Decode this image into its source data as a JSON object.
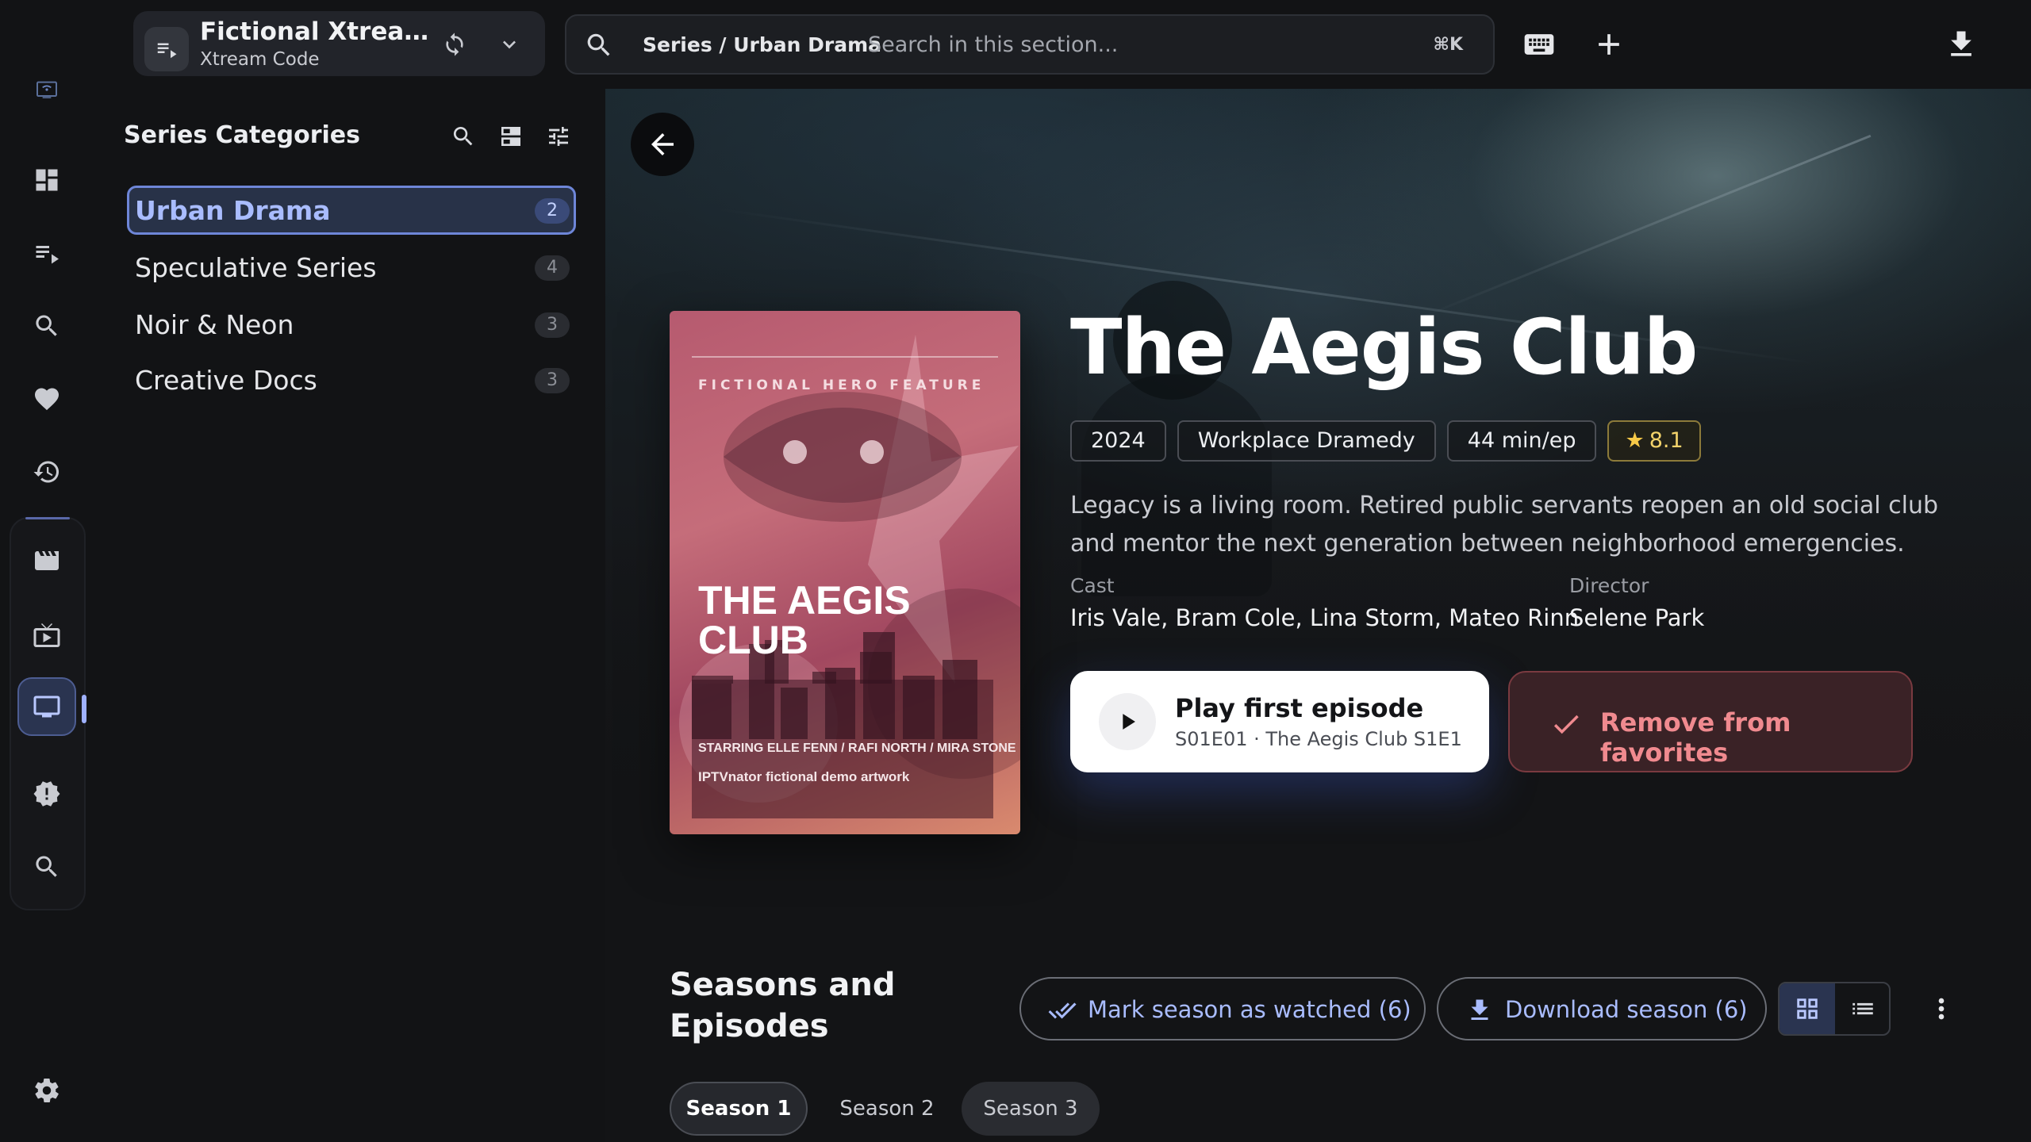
{
  "source": {
    "title": "Fictional Xtream ...",
    "subtitle": "Xtream Code"
  },
  "search": {
    "breadcrumb": "Series / Urban Drama",
    "placeholder": "Search in this section...",
    "shortcut": "⌘K"
  },
  "sidebar": {
    "title": "Series Categories",
    "categories": [
      {
        "label": "Urban Drama",
        "count": "2",
        "active": true
      },
      {
        "label": "Speculative Series",
        "count": "4",
        "active": false
      },
      {
        "label": "Noir & Neon",
        "count": "3",
        "active": false
      },
      {
        "label": "Creative Docs",
        "count": "3",
        "active": false
      }
    ]
  },
  "poster": {
    "kicker": "FICTIONAL HERO FEATURE",
    "title_line1": "THE AEGIS",
    "title_line2": "CLUB",
    "starring": "STARRING ELLE FENN / RAFI NORTH / MIRA STONE",
    "credit": "IPTVnator fictional demo artwork"
  },
  "series": {
    "title": "The Aegis Club",
    "year": "2024",
    "genre": "Workplace Dramedy",
    "duration": "44 min/ep",
    "rating": "8.1",
    "synopsis": "Legacy is a living room. Retired public servants reopen an old social club and mentor the next generation between neighborhood emergencies.",
    "cast_label": "Cast",
    "cast": "Iris Vale, Bram Cole, Lina Storm, Mateo Rinn",
    "director_label": "Director",
    "director": "Selene Park"
  },
  "actions": {
    "play_title": "Play first episode",
    "play_sub": "S01E01 · The Aegis Club S1E1",
    "favorite": "Remove from favorites"
  },
  "seasons": {
    "title": "Seasons and Episodes",
    "mark_watched": "Mark season as watched (6)",
    "download": "Download season (6)",
    "tabs": [
      "Season 1",
      "Season 2",
      "Season 3"
    ],
    "active_tab": 0
  },
  "colors": {
    "accent": "#a9bcff",
    "danger": "#f08a8f",
    "rating": "#f3d36b"
  }
}
